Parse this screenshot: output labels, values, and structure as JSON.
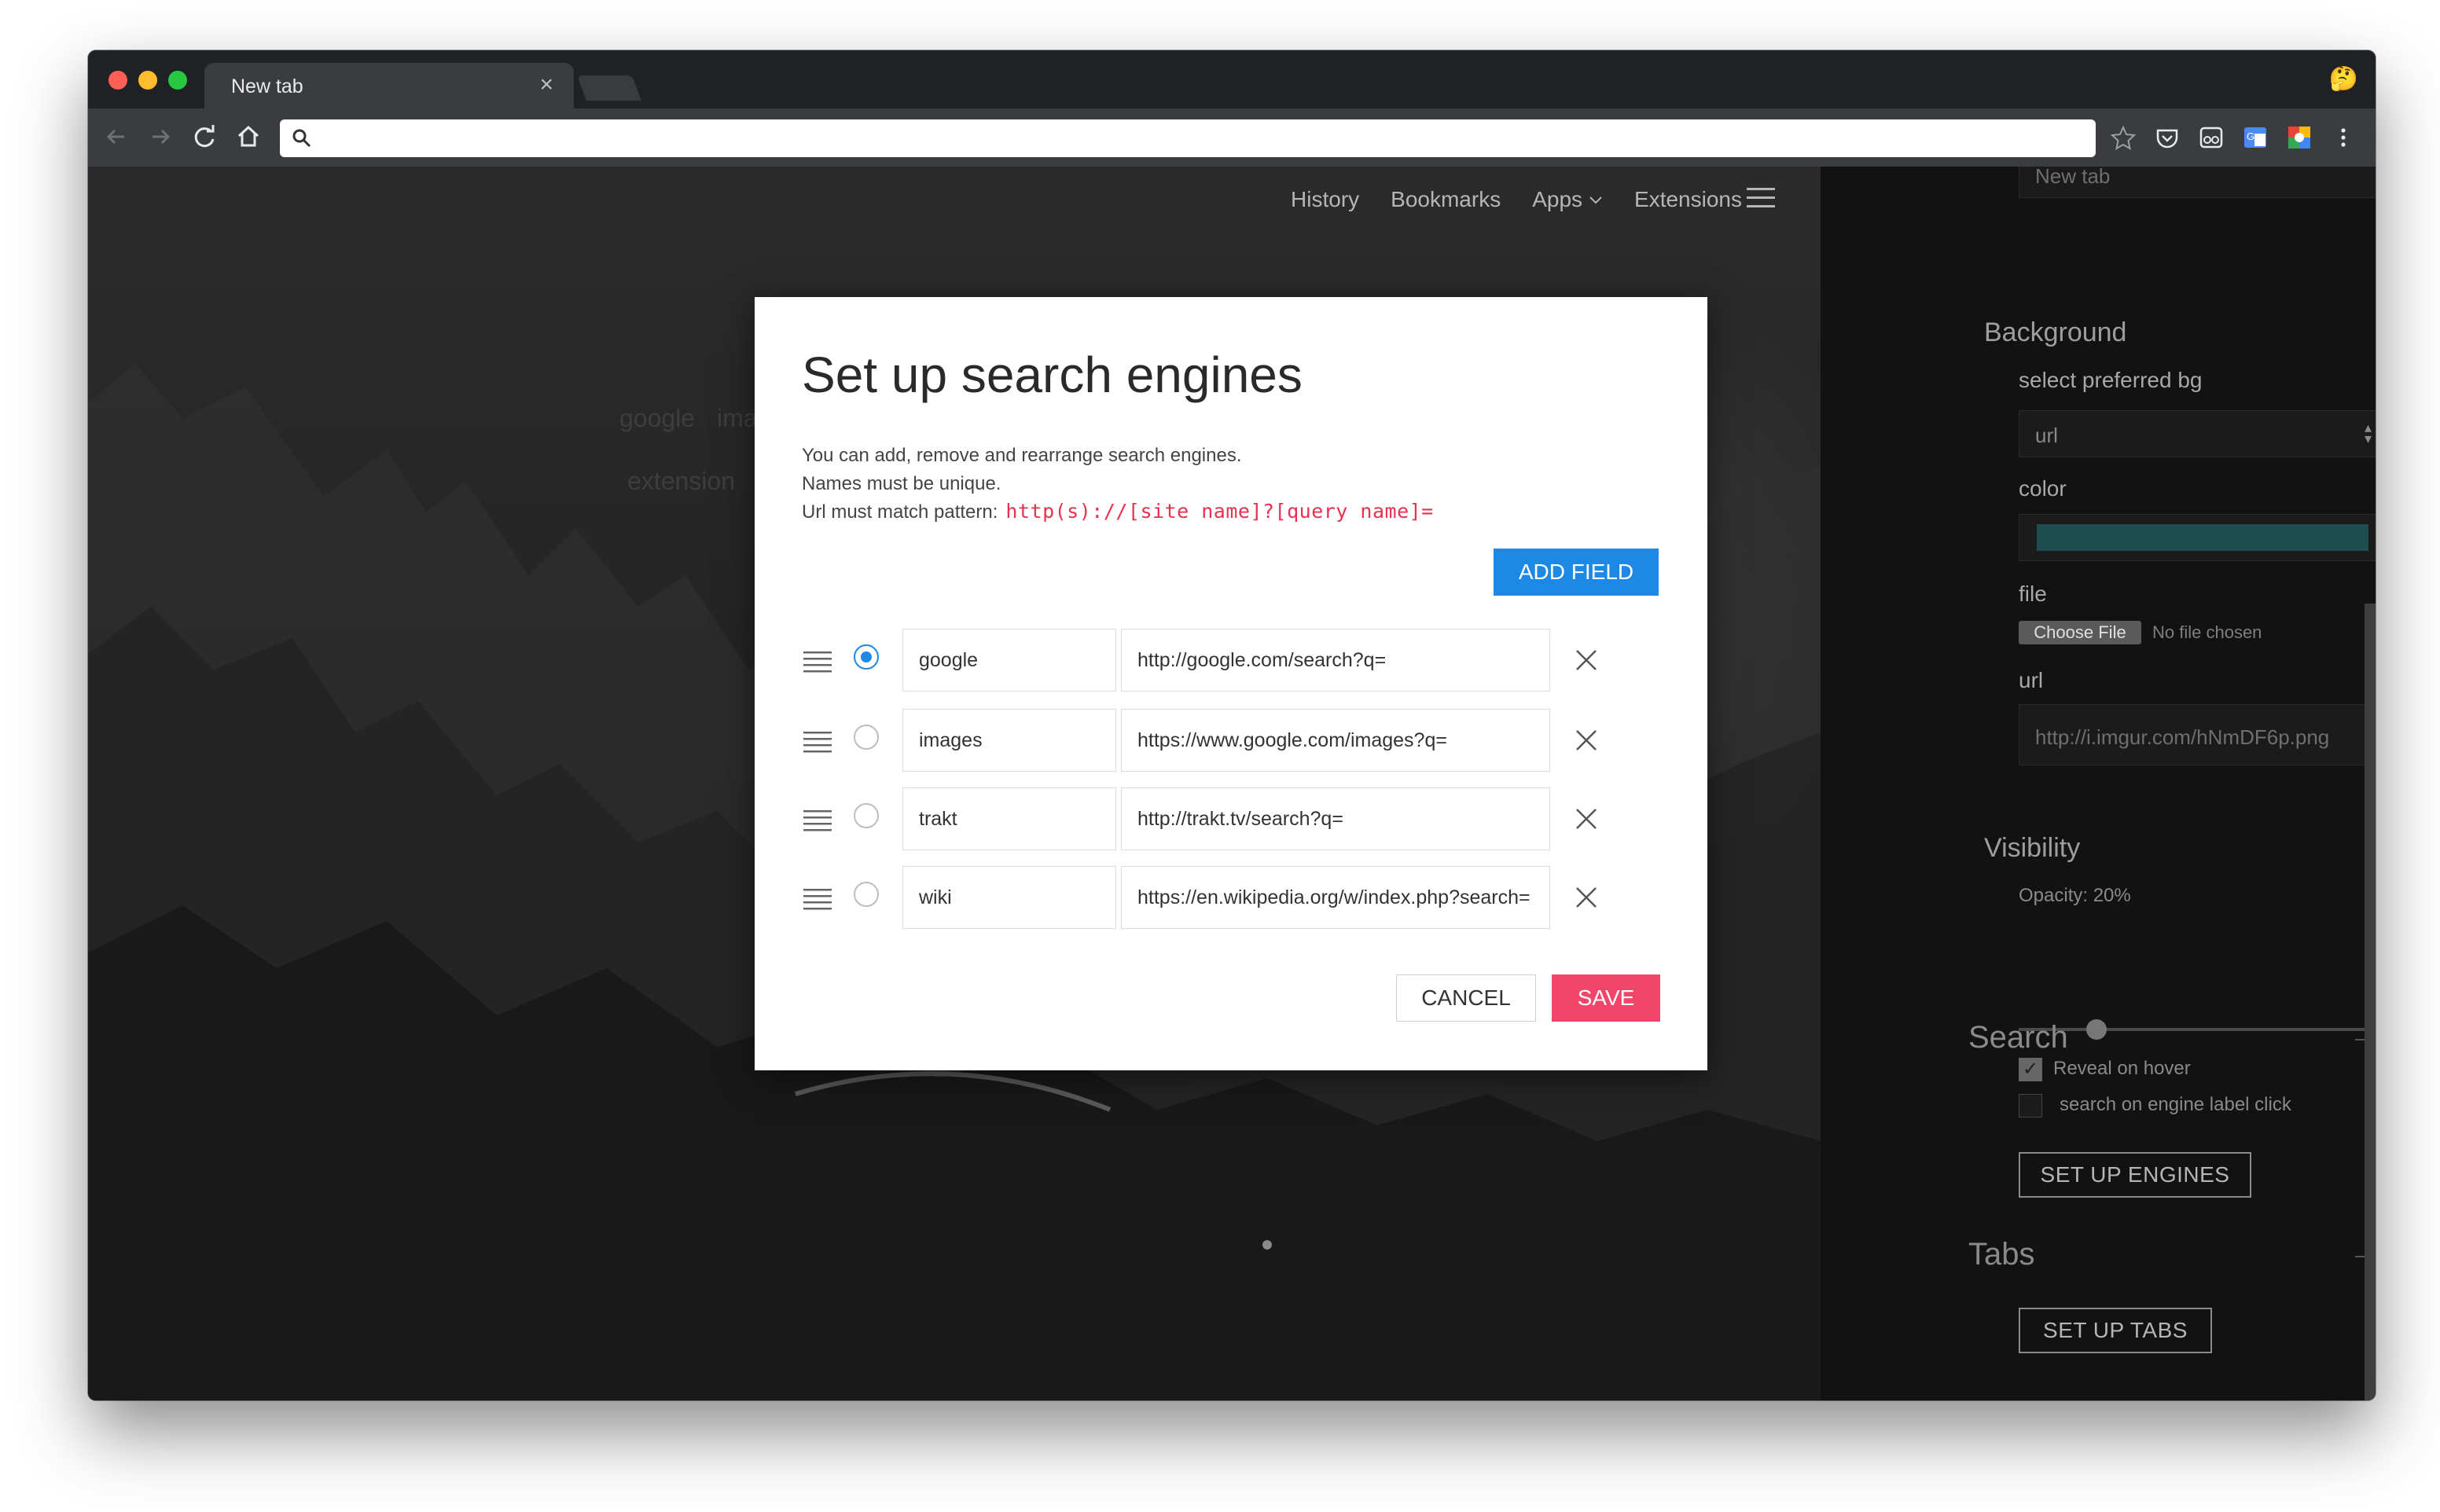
{
  "browser": {
    "tab_title": "New tab",
    "tab_close": "×",
    "address_value": "",
    "profile_emoji": "🤔"
  },
  "page": {
    "nav": {
      "history": "History",
      "bookmarks": "Bookmarks",
      "apps": "Apps",
      "extensions": "Extensions"
    },
    "ghost": {
      "engine_1": "google",
      "engine_2": "ima",
      "search_placeholder": "extension"
    }
  },
  "settings": {
    "tab_name_placeholder": "New tab",
    "background": {
      "heading": "Background",
      "select_label": "select preferred bg",
      "select_value": "url",
      "color_label": "color",
      "color_value": "#1f4e52",
      "file_label": "file",
      "choose_file": "Choose File",
      "no_file": "No file chosen",
      "url_label": "url",
      "url_value": "http://i.imgur.com/hNmDF6p.png"
    },
    "visibility": {
      "heading": "Visibility",
      "opacity_label": "Opacity: 20%",
      "opacity_value": 0.2,
      "reveal_label": "Reveal on hover",
      "reveal_checked": true
    },
    "search": {
      "heading": "Search",
      "label_click": "search on engine label click",
      "label_click_checked": false,
      "button": "SET UP ENGINES"
    },
    "tabs": {
      "heading": "Tabs",
      "button": "SET UP TABS"
    }
  },
  "dialog": {
    "title": "Set up search engines",
    "line1": "You can add, remove and rearrange search engines.",
    "line2": "Names must be unique.",
    "line3": "Url must match pattern:",
    "pattern": "http(s)://[site name]?[query name]=",
    "add_field": "ADD FIELD",
    "engines": [
      {
        "name": "google",
        "url": "http://google.com/search?q=",
        "selected": true
      },
      {
        "name": "images",
        "url": "https://www.google.com/images?q=",
        "selected": false
      },
      {
        "name": "trakt",
        "url": "http://trakt.tv/search?q=",
        "selected": false
      },
      {
        "name": "wiki",
        "url": "https://en.wikipedia.org/w/index.php?search=",
        "selected": false
      }
    ],
    "cancel": "CANCEL",
    "save": "SAVE"
  },
  "colors": {
    "accent_blue": "#1e88e5",
    "save_pink": "#f0466a",
    "code_red": "#e8304f"
  }
}
